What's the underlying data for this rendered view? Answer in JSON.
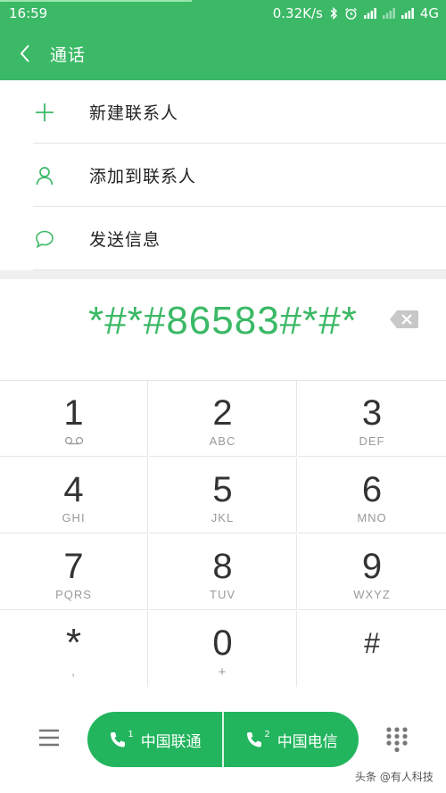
{
  "status_bar": {
    "time": "16:59",
    "net_speed": "0.32K/s",
    "network": "4G",
    "icons": [
      "bluetooth-icon",
      "alarm-icon",
      "signal-icon",
      "signal-empty-icon",
      "signal-icon"
    ]
  },
  "header": {
    "title": "通话",
    "back_icon": "chevron-left-icon"
  },
  "menu": [
    {
      "label": "新建联系人",
      "icon": "plus-icon"
    },
    {
      "label": "添加到联系人",
      "icon": "person-icon"
    },
    {
      "label": "发送信息",
      "icon": "message-icon"
    }
  ],
  "dial_display": {
    "number": "*#*#86583#*#*",
    "backspace_icon": "backspace-icon"
  },
  "keypad": [
    {
      "digit": "1",
      "sub": ""
    },
    {
      "digit": "2",
      "sub": "ABC"
    },
    {
      "digit": "3",
      "sub": "DEF"
    },
    {
      "digit": "4",
      "sub": "GHI"
    },
    {
      "digit": "5",
      "sub": "JKL"
    },
    {
      "digit": "6",
      "sub": "MNO"
    },
    {
      "digit": "7",
      "sub": "PQRS"
    },
    {
      "digit": "8",
      "sub": "TUV"
    },
    {
      "digit": "9",
      "sub": "WXYZ"
    },
    {
      "digit": "*",
      "sub": ","
    },
    {
      "digit": "0",
      "sub": "+"
    },
    {
      "digit": "#",
      "sub": ""
    }
  ],
  "bottom_bar": {
    "sim1_label": "中国联通",
    "sim2_label": "中国电信",
    "sim1_index": "1",
    "sim2_index": "2"
  },
  "watermark": "头条 @有人科技",
  "colors": {
    "accent": "#3bb966",
    "call_button": "#22b55d"
  }
}
